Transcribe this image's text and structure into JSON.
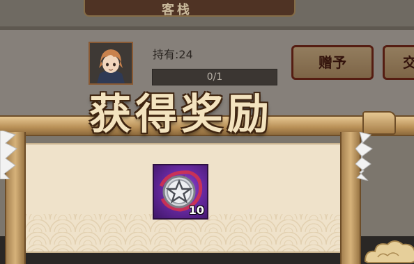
{
  "background": {
    "banner_title": "客栈",
    "hold_label": "持有:",
    "hold_count": "24",
    "progress": {
      "text": "0/1",
      "fraction": 0
    },
    "gift_button_label": "赠予",
    "exchange_button_label": "交"
  },
  "reward_popup": {
    "title": "获得奖励",
    "items": [
      {
        "icon": "silver-pentagram-coin-icon",
        "count": "10",
        "rarity_color": "#7b3bc0"
      }
    ]
  },
  "colors": {
    "title_fill": "#f3e3bf",
    "title_outline": "#3b2210",
    "board": "#efe2ca",
    "wood": "#c9a26a",
    "button_border": "#7d2b1b"
  }
}
